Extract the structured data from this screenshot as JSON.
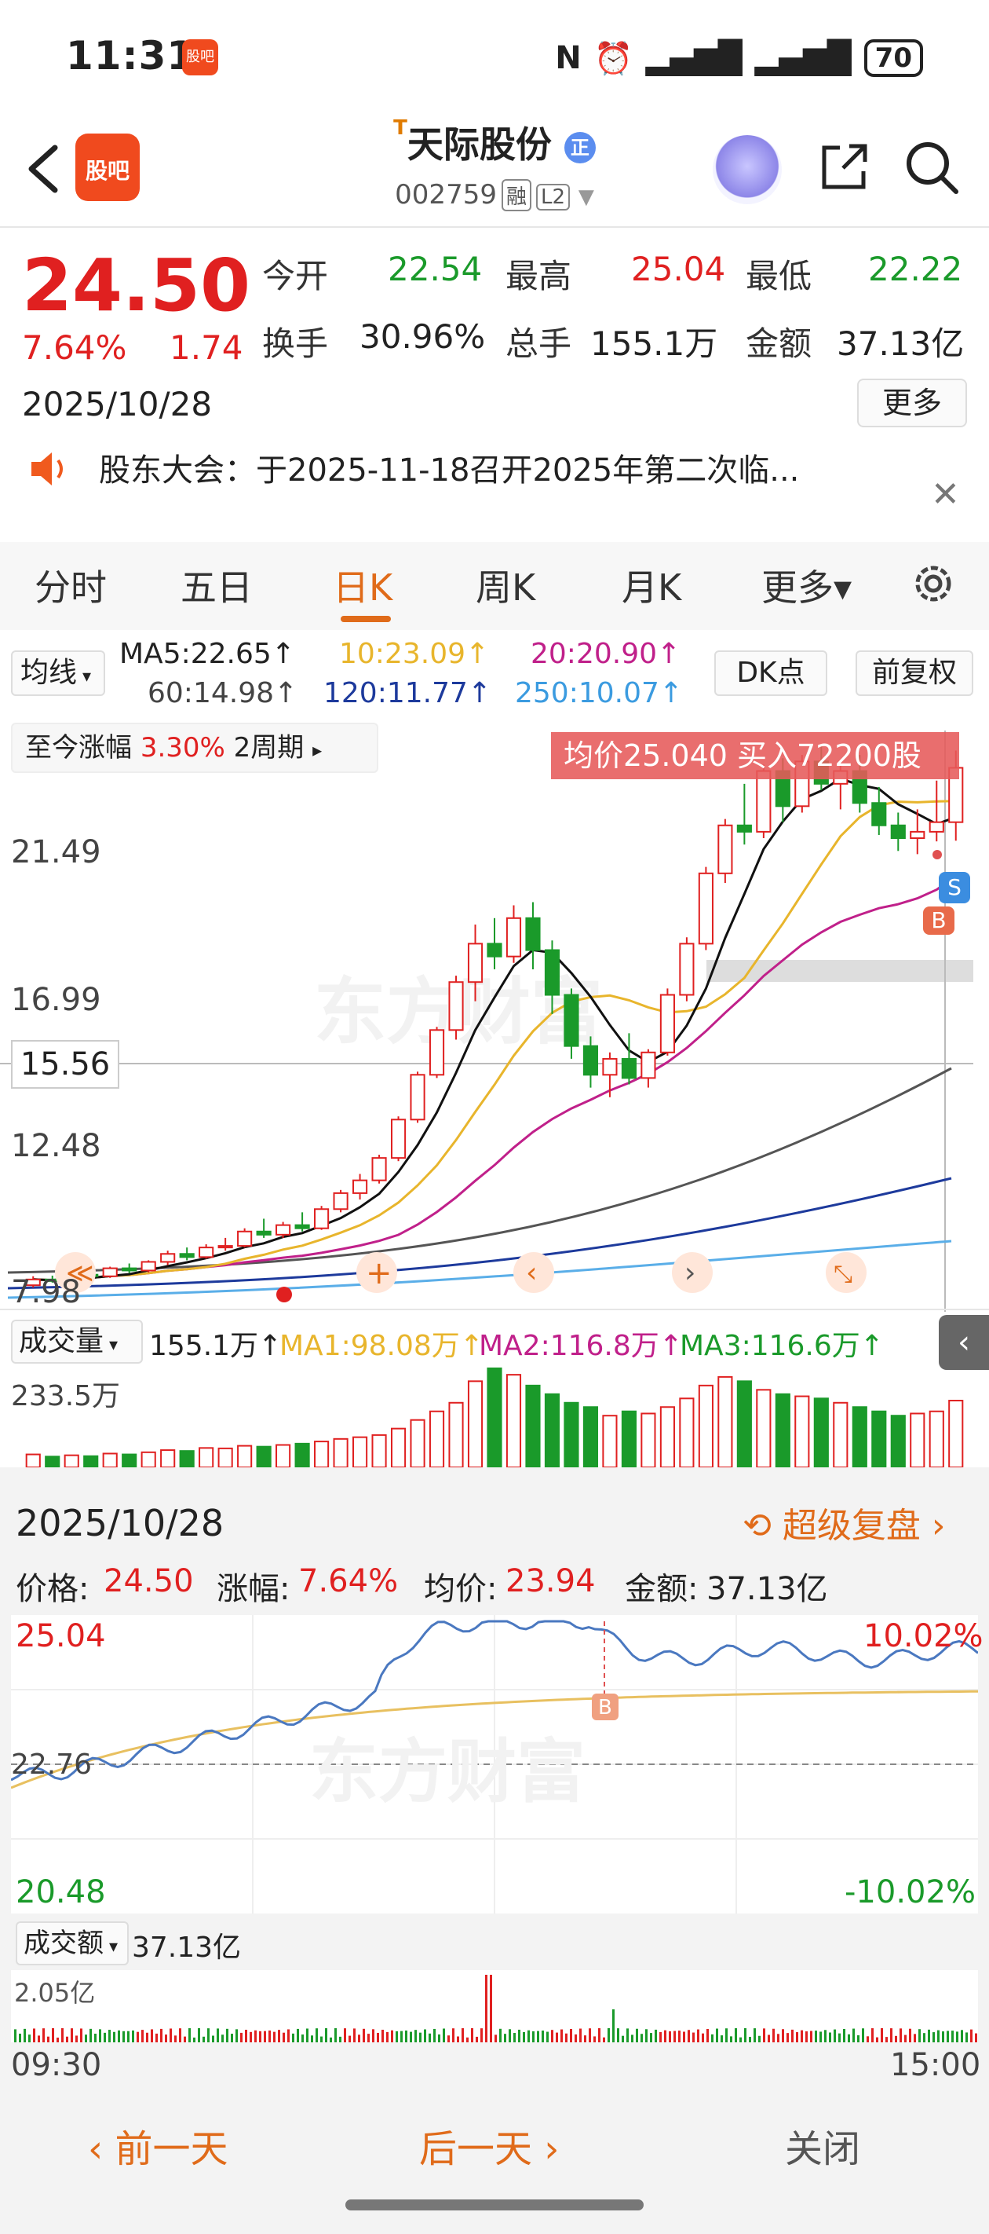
{
  "status_bar": {
    "time": "11:31",
    "mini_app": "股吧",
    "battery": "70"
  },
  "header": {
    "back_icon": "chevron-left-icon",
    "logo_label": "股吧",
    "title_prefix": "T",
    "title": "天际股份",
    "title_badge": "正",
    "code": "002759",
    "tag_margin": "融",
    "tag_level": "L2",
    "share_icon": "share-icon",
    "search_icon": "search-icon"
  },
  "quote": {
    "price": "24.50",
    "change_pct": "7.64%",
    "change_amt": "1.74",
    "date": "2025/10/28",
    "open_label": "今开",
    "open": "22.54",
    "high_label": "最高",
    "high": "25.04",
    "low_label": "最低",
    "low": "22.22",
    "turnover_label": "换手",
    "turnover": "30.96%",
    "volume_label": "总手",
    "volume": "155.1万",
    "amount_label": "金额",
    "amount": "37.13亿",
    "more_button": "更多"
  },
  "notice": {
    "text": "股东大会：于2025-11-18召开2025年第二次临...",
    "icon": "speaker-icon"
  },
  "tabs": [
    "分时",
    "五日",
    "日K",
    "周K",
    "月K",
    "更多▾"
  ],
  "active_tab": "日K",
  "ma": {
    "selector": "均线",
    "ma5": "MA5:22.65↑",
    "ma10": "10:23.09↑",
    "ma20": "20:20.90↑",
    "ma60": "60:14.98↑",
    "ma120": "120:11.77↑",
    "ma250": "250:10.07↑",
    "dk_button": "DK点",
    "fq_button": "前复权",
    "colors": {
      "ma5": "#111111",
      "ma10": "#e8b52c",
      "ma20": "#c0208a",
      "ma60": "#555555",
      "ma120": "#1d3a9c",
      "ma250": "#5aaee8"
    }
  },
  "since": {
    "label": "至今涨幅",
    "value": "3.30%",
    "period": "2周期"
  },
  "avg_banner": "均价25.040  买入72200股",
  "kline": {
    "y_labels": [
      "21.49",
      "16.99",
      "12.48",
      "7.98"
    ],
    "last_price": "15.56",
    "marker_s": "S",
    "marker_b": "B"
  },
  "volume": {
    "selector": "成交量",
    "total": "155.1万↑",
    "ma1": "MA1:98.08万↑",
    "ma2": "MA2:116.8万↑",
    "ma3": "MA3:116.6万↑",
    "y_max": "233.5万"
  },
  "panel": {
    "date": "2025/10/28",
    "replay": "超级复盘",
    "price_label": "价格:",
    "price": "24.50",
    "chg_label": "涨幅:",
    "chg": "7.64%",
    "avg_label": "均价:",
    "avg": "23.94",
    "amt_label": "金额:",
    "amt": "37.13亿",
    "y_top": "25.04",
    "y_mid": "22.76",
    "y_bot": "20.48",
    "pct_top": "10.02%",
    "pct_bot": "-10.02%",
    "amount_selector": "成交额",
    "amount_total": "37.13亿",
    "amount_max": "2.05亿",
    "time_start": "09:30",
    "time_end": "15:00"
  },
  "bottom": {
    "prev": "前一天",
    "next": "后一天",
    "close": "关闭"
  },
  "candles": {
    "up_color": "#e02020",
    "down_color": "#1a9a2a",
    "ohlc": [
      [
        8.32,
        8.6,
        8.25,
        8.5
      ],
      [
        8.5,
        8.62,
        8.4,
        8.45
      ],
      [
        8.45,
        8.7,
        8.4,
        8.65
      ],
      [
        8.65,
        8.8,
        8.55,
        8.6
      ],
      [
        8.6,
        8.9,
        8.55,
        8.85
      ],
      [
        8.85,
        9.0,
        8.7,
        8.78
      ],
      [
        8.78,
        9.1,
        8.72,
        9.05
      ],
      [
        9.05,
        9.4,
        8.95,
        9.3
      ],
      [
        9.3,
        9.5,
        9.1,
        9.2
      ],
      [
        9.2,
        9.6,
        9.15,
        9.5
      ],
      [
        9.5,
        9.8,
        9.4,
        9.55
      ],
      [
        9.55,
        10.1,
        9.5,
        10.0
      ],
      [
        10.0,
        10.4,
        9.8,
        9.9
      ],
      [
        9.9,
        10.3,
        9.8,
        10.2
      ],
      [
        10.2,
        10.6,
        10.0,
        10.1
      ],
      [
        10.1,
        10.8,
        10.05,
        10.7
      ],
      [
        10.7,
        11.3,
        10.6,
        11.2
      ],
      [
        11.2,
        11.8,
        11.0,
        11.6
      ],
      [
        11.6,
        12.4,
        11.5,
        12.3
      ],
      [
        12.3,
        13.6,
        12.2,
        13.5
      ],
      [
        13.5,
        15.0,
        13.4,
        14.9
      ],
      [
        14.9,
        16.4,
        14.8,
        16.3
      ],
      [
        16.3,
        18.0,
        16.0,
        17.8
      ],
      [
        17.8,
        19.6,
        17.2,
        19.0
      ],
      [
        19.0,
        19.8,
        18.2,
        18.6
      ],
      [
        18.6,
        20.2,
        18.4,
        19.8
      ],
      [
        19.8,
        20.3,
        18.2,
        18.8
      ],
      [
        18.8,
        19.1,
        16.8,
        17.4
      ],
      [
        17.4,
        17.6,
        15.4,
        15.8
      ],
      [
        15.8,
        16.1,
        14.5,
        14.9
      ],
      [
        14.9,
        15.6,
        14.2,
        15.4
      ],
      [
        15.4,
        16.2,
        14.6,
        14.8
      ],
      [
        14.8,
        15.7,
        14.5,
        15.6
      ],
      [
        15.6,
        17.6,
        15.5,
        17.4
      ],
      [
        17.4,
        19.2,
        17.2,
        19.0
      ],
      [
        19.0,
        21.4,
        18.8,
        21.2
      ],
      [
        21.2,
        22.9,
        20.9,
        22.7
      ],
      [
        22.7,
        24.0,
        22.1,
        22.5
      ],
      [
        22.5,
        24.6,
        22.3,
        24.4
      ],
      [
        24.4,
        24.8,
        22.8,
        23.3
      ],
      [
        23.3,
        24.9,
        23.1,
        24.7
      ],
      [
        24.7,
        25.2,
        23.8,
        24.0
      ],
      [
        24.0,
        24.6,
        23.2,
        24.4
      ],
      [
        24.4,
        24.9,
        23.1,
        23.4
      ],
      [
        23.4,
        23.9,
        22.4,
        22.7
      ],
      [
        22.7,
        23.1,
        21.9,
        22.3
      ],
      [
        22.3,
        23.2,
        21.8,
        22.5
      ],
      [
        22.5,
        24.1,
        22.2,
        22.8
      ],
      [
        22.8,
        25.04,
        22.22,
        24.5
      ]
    ]
  },
  "volumes": [
    30,
    25,
    28,
    26,
    32,
    30,
    35,
    40,
    38,
    45,
    44,
    50,
    48,
    52,
    55,
    60,
    66,
    70,
    75,
    90,
    110,
    130,
    150,
    200,
    230,
    215,
    190,
    170,
    150,
    140,
    120,
    130,
    125,
    140,
    160,
    190,
    210,
    200,
    180,
    170,
    165,
    160,
    150,
    140,
    130,
    120,
    125,
    130,
    155
  ]
}
